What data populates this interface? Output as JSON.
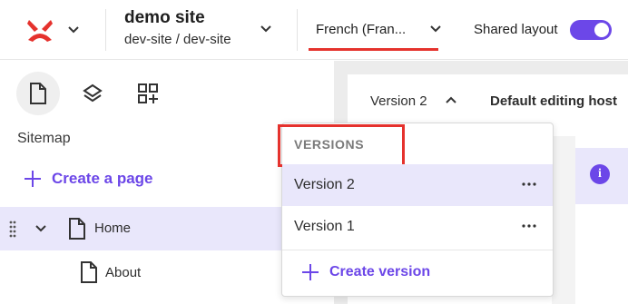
{
  "header": {
    "site_title": "demo site",
    "site_path": "dev-site / dev-site",
    "language": "French (Fran...",
    "shared_layout_label": "Shared layout",
    "shared_layout_on": true
  },
  "icons": {
    "logo": "brand-logo-icon",
    "page": "page-icon",
    "layers": "layers-icon",
    "components": "components-icon",
    "info": "info-icon",
    "more": "more-horizontal-icon"
  },
  "sidebar": {
    "title": "Sitemap",
    "create_page": "Create a page",
    "tree": [
      {
        "label": "Home",
        "selected": true,
        "expanded": true
      },
      {
        "label": "About",
        "selected": false
      }
    ]
  },
  "main": {
    "version_label": "Version 2",
    "editing_host": "Default editing host",
    "info_glyph": "i"
  },
  "versions_menu": {
    "header": "VERSIONS",
    "items": [
      {
        "label": "Version 2",
        "selected": true
      },
      {
        "label": "Version 1",
        "selected": false
      }
    ],
    "create_label": "Create version"
  },
  "colors": {
    "accent": "#6c47e8",
    "highlight": "#e5322d",
    "selected_bg": "#e9e7fb"
  }
}
